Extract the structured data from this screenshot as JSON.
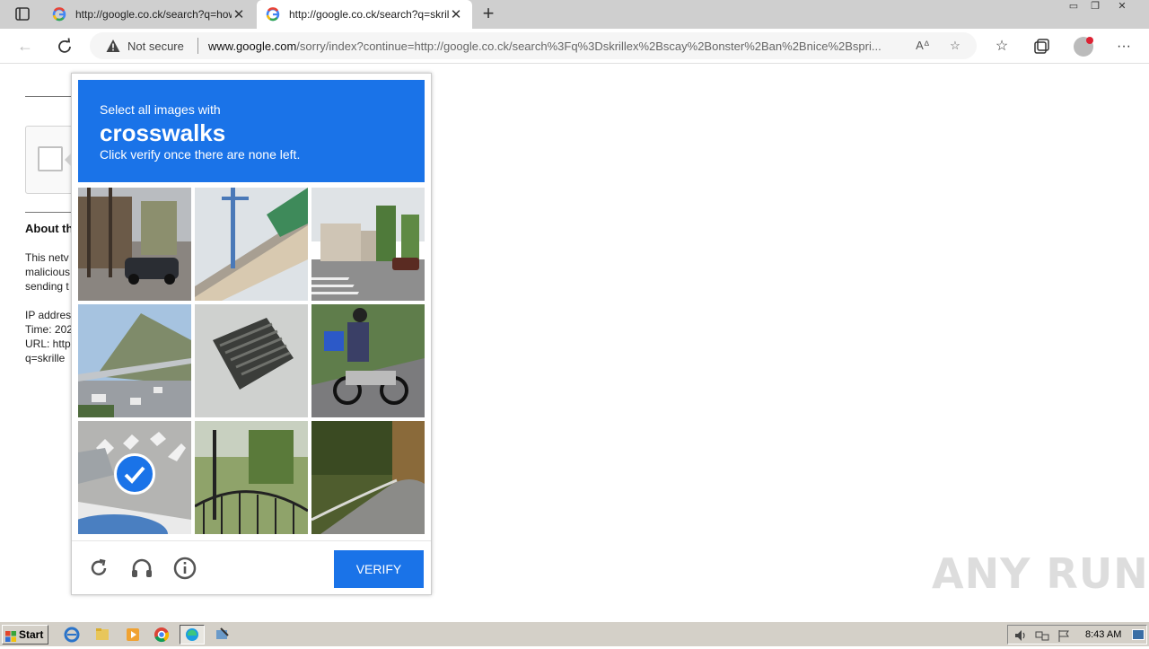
{
  "browser": {
    "tabs": [
      {
        "title": "http://google.co.ck/search?q=how",
        "active": false
      },
      {
        "title": "http://google.co.ck/search?q=skrillex",
        "active": true
      }
    ],
    "new_tab_label": "+",
    "security_label": "Not secure",
    "url_host": "www.google.com",
    "url_rest": "/sorry/index?continue=http://google.co.ck/search%3Fq%3Dskrillex%2Bscay%2Bonster%2Ban%2Bnice%2Bspri..."
  },
  "background_page": {
    "heading": "About th",
    "paragraph_lines": [
      "This netv",
      "malicious",
      "sending t"
    ],
    "info_lines": [
      "IP addres",
      "Time: 202",
      "URL: http",
      "q=skrille"
    ]
  },
  "captcha": {
    "instruction_top": "Select all images with",
    "target": "crosswalks",
    "instruction_bottom": "Click verify once there are none left.",
    "verify_label": "VERIFY",
    "tiles": [
      {
        "name": "street-with-car",
        "selected": false
      },
      {
        "name": "overpass-pole",
        "selected": false
      },
      {
        "name": "street-houses-crosswalk",
        "selected": false
      },
      {
        "name": "highway-mountain",
        "selected": false
      },
      {
        "name": "vent-grate",
        "selected": false
      },
      {
        "name": "motorcycle-rider",
        "selected": false
      },
      {
        "name": "crosswalk-closeup",
        "selected": true
      },
      {
        "name": "garden-fence",
        "selected": false
      },
      {
        "name": "curving-road",
        "selected": false
      }
    ]
  },
  "watermark": "ANY RUN",
  "taskbar": {
    "start_label": "Start",
    "clock": "8:43 AM"
  }
}
